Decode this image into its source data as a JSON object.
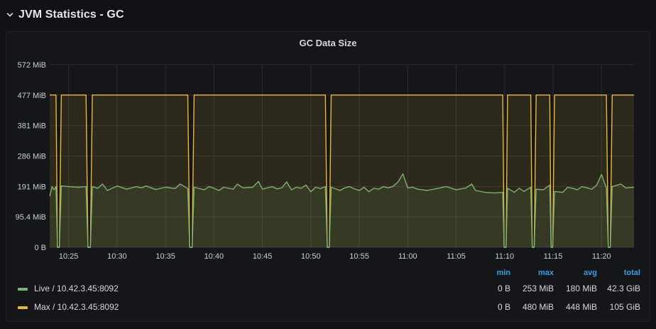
{
  "row": {
    "title": "JVM Statistics - GC"
  },
  "panel": {
    "title": "GC Data Size",
    "legend": {
      "headers": {
        "min": "min",
        "max": "max",
        "avg": "avg",
        "total": "total"
      },
      "series": [
        {
          "name": "Live / 10.42.3.45:8092",
          "color": "#7eb26d",
          "min": "0 B",
          "max": "253 MiB",
          "avg": "180 MiB",
          "total": "42.3 GiB"
        },
        {
          "name": "Max / 10.42.3.45:8092",
          "color": "#eab839",
          "min": "0 B",
          "max": "480 MiB",
          "avg": "448 MiB",
          "total": "105 GiB"
        }
      ]
    }
  },
  "chart_data": {
    "type": "area",
    "y_ticks": [
      "0 B",
      "95.4 MiB",
      "191 MiB",
      "286 MiB",
      "381 MiB",
      "477 MiB",
      "572 MiB"
    ],
    "x_ticks": [
      "10:25",
      "10:30",
      "10:35",
      "10:40",
      "10:45",
      "10:50",
      "10:55",
      "11:00",
      "11:05",
      "11:10",
      "11:15",
      "11:20"
    ],
    "x_tick_minutes": [
      25,
      30,
      35,
      40,
      45,
      50,
      55,
      60,
      65,
      70,
      75,
      80
    ],
    "xlim_minutes": [
      23.05,
      83.35
    ],
    "ylim_mib": [
      0,
      572
    ],
    "grid": true,
    "series": [
      {
        "name": "Max / 10.42.3.45:8092",
        "unit": "MiB",
        "points": [
          [
            23.05,
            477
          ],
          [
            23.7,
            477
          ],
          [
            23.85,
            0
          ],
          [
            24.05,
            0
          ],
          [
            24.25,
            477
          ],
          [
            26.8,
            477
          ],
          [
            27.0,
            0
          ],
          [
            27.25,
            0
          ],
          [
            27.45,
            477
          ],
          [
            37.3,
            477
          ],
          [
            37.5,
            0
          ],
          [
            37.75,
            0
          ],
          [
            37.95,
            477
          ],
          [
            51.5,
            477
          ],
          [
            51.7,
            0
          ],
          [
            51.9,
            0
          ],
          [
            52.1,
            477
          ],
          [
            69.8,
            477
          ],
          [
            69.95,
            0
          ],
          [
            70.15,
            0
          ],
          [
            70.3,
            477
          ],
          [
            72.7,
            477
          ],
          [
            72.85,
            0
          ],
          [
            73.05,
            0
          ],
          [
            73.25,
            477
          ],
          [
            74.65,
            477
          ],
          [
            74.8,
            0
          ],
          [
            74.95,
            0
          ],
          [
            75.15,
            477
          ],
          [
            80.5,
            477
          ],
          [
            80.7,
            0
          ],
          [
            80.9,
            0
          ],
          [
            81.1,
            477
          ],
          [
            83.35,
            477
          ]
        ]
      },
      {
        "name": "Live / 10.42.3.45:8092",
        "unit": "MiB",
        "points": [
          [
            23.05,
            160
          ],
          [
            23.3,
            190
          ],
          [
            23.5,
            180
          ],
          [
            23.7,
            190
          ],
          [
            23.85,
            0
          ],
          [
            24.05,
            0
          ],
          [
            24.25,
            192
          ],
          [
            25,
            190
          ],
          [
            26,
            188
          ],
          [
            26.8,
            190
          ],
          [
            27.0,
            0
          ],
          [
            27.25,
            0
          ],
          [
            27.45,
            190
          ],
          [
            28,
            185
          ],
          [
            28.5,
            198
          ],
          [
            29,
            178
          ],
          [
            29.5,
            185
          ],
          [
            30,
            192
          ],
          [
            31,
            182
          ],
          [
            32,
            190
          ],
          [
            32.5,
            186
          ],
          [
            33,
            192
          ],
          [
            34,
            181
          ],
          [
            35,
            188
          ],
          [
            36,
            184
          ],
          [
            36.5,
            198
          ],
          [
            37.3,
            184
          ],
          [
            37.5,
            0
          ],
          [
            37.75,
            0
          ],
          [
            37.95,
            188
          ],
          [
            39,
            180
          ],
          [
            39.5,
            190
          ],
          [
            40,
            185
          ],
          [
            40.5,
            178
          ],
          [
            41,
            188
          ],
          [
            42,
            182
          ],
          [
            42.4,
            198
          ],
          [
            43,
            186
          ],
          [
            44,
            188
          ],
          [
            44.6,
            206
          ],
          [
            45,
            182
          ],
          [
            46,
            190
          ],
          [
            46.5,
            183
          ],
          [
            47,
            186
          ],
          [
            47.5,
            205
          ],
          [
            48,
            180
          ],
          [
            48.5,
            188
          ],
          [
            49,
            185
          ],
          [
            49.5,
            195
          ],
          [
            50,
            174
          ],
          [
            50.5,
            188
          ],
          [
            51,
            184
          ],
          [
            51.5,
            190
          ],
          [
            51.7,
            0
          ],
          [
            51.9,
            0
          ],
          [
            52.1,
            188
          ],
          [
            53,
            178
          ],
          [
            53.5,
            186
          ],
          [
            54,
            190
          ],
          [
            54.5,
            183
          ],
          [
            55,
            178
          ],
          [
            55.5,
            188
          ],
          [
            56,
            174
          ],
          [
            56.5,
            185
          ],
          [
            57,
            182
          ],
          [
            57.5,
            190
          ],
          [
            58,
            186
          ],
          [
            58.5,
            191
          ],
          [
            59,
            205
          ],
          [
            59.5,
            230
          ],
          [
            60,
            186
          ],
          [
            60.5,
            188
          ],
          [
            61,
            182
          ],
          [
            62,
            178
          ],
          [
            63,
            184
          ],
          [
            64,
            190
          ],
          [
            65,
            180
          ],
          [
            66,
            186
          ],
          [
            66.6,
            198
          ],
          [
            67,
            178
          ],
          [
            68,
            172
          ],
          [
            69,
            170
          ],
          [
            69.8,
            172
          ],
          [
            69.95,
            0
          ],
          [
            70.15,
            0
          ],
          [
            70.3,
            185
          ],
          [
            71,
            172
          ],
          [
            71.5,
            185
          ],
          [
            72,
            175
          ],
          [
            72.7,
            188
          ],
          [
            72.85,
            0
          ],
          [
            73.05,
            0
          ],
          [
            73.25,
            182
          ],
          [
            74,
            180
          ],
          [
            74.65,
            195
          ],
          [
            74.8,
            0
          ],
          [
            74.95,
            0
          ],
          [
            75.15,
            175
          ],
          [
            76,
            172
          ],
          [
            76.5,
            188
          ],
          [
            77,
            185
          ],
          [
            77.5,
            180
          ],
          [
            78,
            190
          ],
          [
            79,
            182
          ],
          [
            79.5,
            195
          ],
          [
            80,
            228
          ],
          [
            80.5,
            185
          ],
          [
            80.7,
            0
          ],
          [
            80.9,
            0
          ],
          [
            81.1,
            190
          ],
          [
            82,
            198
          ],
          [
            82.5,
            186
          ],
          [
            83.35,
            188
          ]
        ]
      }
    ]
  }
}
